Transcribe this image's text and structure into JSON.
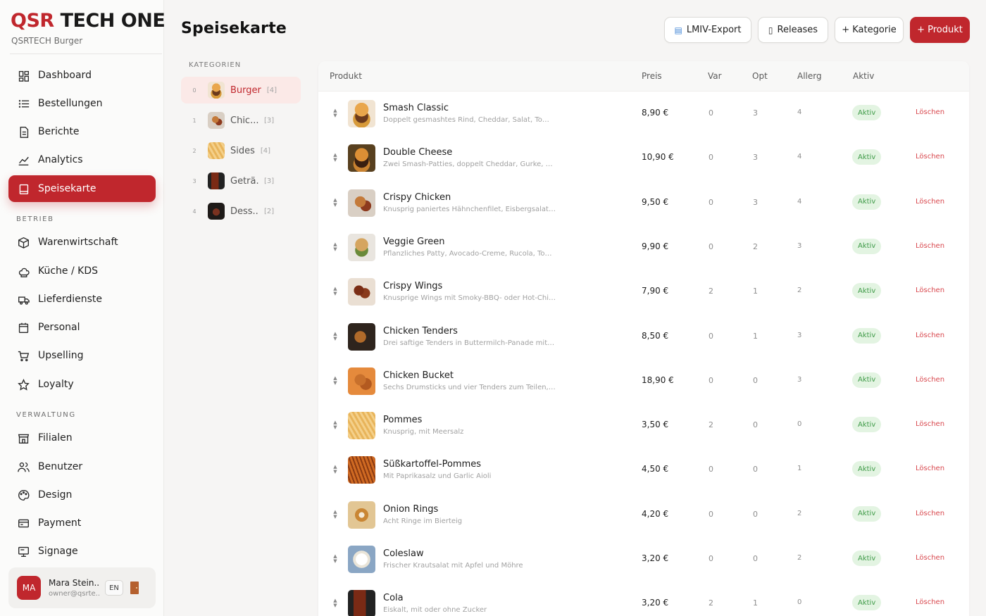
{
  "brand": {
    "qsr": "QSR",
    "rest": " TECH ONE",
    "subtitle": "QSRTECH Burger"
  },
  "nav": {
    "main": [
      {
        "label": "Dashboard",
        "icon": "dashboard-icon"
      },
      {
        "label": "Bestellungen",
        "icon": "list-icon"
      },
      {
        "label": "Berichte",
        "icon": "report-icon"
      },
      {
        "label": "Analytics",
        "icon": "chart-icon"
      },
      {
        "label": "Speisekarte",
        "icon": "menu-book-icon",
        "active": true
      }
    ],
    "betrieb_label": "BETRIEB",
    "betrieb": [
      {
        "label": "Warenwirtschaft",
        "icon": "box-icon"
      },
      {
        "label": "Küche / KDS",
        "icon": "chef-hat-icon"
      },
      {
        "label": "Lieferdienste",
        "icon": "truck-icon"
      },
      {
        "label": "Personal",
        "icon": "calendar-icon"
      },
      {
        "label": "Upselling",
        "icon": "cart-icon"
      },
      {
        "label": "Loyalty",
        "icon": "star-icon"
      }
    ],
    "verwaltung_label": "VERWALTUNG",
    "verwaltung": [
      {
        "label": "Filialen",
        "icon": "store-icon"
      },
      {
        "label": "Benutzer",
        "icon": "users-icon"
      },
      {
        "label": "Design",
        "icon": "palette-icon"
      },
      {
        "label": "Payment",
        "icon": "credit-card-icon"
      },
      {
        "label": "Signage",
        "icon": "monitor-icon"
      }
    ]
  },
  "user": {
    "initials": "MA",
    "name": "Mara Stein...",
    "email": "owner@qsrte...",
    "lang": "EN"
  },
  "header": {
    "title": "Speisekarte",
    "lmiv": "LMIV-Export",
    "releases": "Releases",
    "add_category": "+ Kategorie",
    "add_product": "+ Produkt"
  },
  "categories_label": "KATEGORIEN",
  "categories": [
    {
      "idx": "0",
      "name": "Burger",
      "count": "[4]",
      "active": true,
      "thumb": "burger"
    },
    {
      "idx": "1",
      "name": "Chic...",
      "count": "[3]",
      "thumb": "chicken"
    },
    {
      "idx": "2",
      "name": "Sides",
      "count": "[4]",
      "thumb": "fries"
    },
    {
      "idx": "3",
      "name": "Geträ...",
      "count": "[3]",
      "thumb": "drink"
    },
    {
      "idx": "4",
      "name": "Dess...",
      "count": "[2]",
      "thumb": "dessert"
    }
  ],
  "table": {
    "headers": {
      "product": "Produkt",
      "price": "Preis",
      "var": "Var",
      "opt": "Opt",
      "allerg": "Allerg",
      "active": "Aktiv"
    },
    "rows": [
      {
        "name": "Smash Classic",
        "desc": "Doppelt gesmashtes Rind, Cheddar, Salat, Tomat...",
        "price": "8,90 €",
        "var": "0",
        "opt": "3",
        "allerg": "4",
        "status": "Aktiv",
        "delete": "Löschen",
        "thumb": "burger"
      },
      {
        "name": "Double Cheese",
        "desc": "Zwei Smash-Patties, doppelt Cheddar, Gurke, Zw...",
        "price": "10,90 €",
        "var": "0",
        "opt": "3",
        "allerg": "4",
        "status": "Aktiv",
        "delete": "Löschen",
        "thumb": "burger2"
      },
      {
        "name": "Crispy Chicken",
        "desc": "Knusprig paniertes Hähnchenfilet, Eisbergsalat, ...",
        "price": "9,50 €",
        "var": "0",
        "opt": "3",
        "allerg": "4",
        "status": "Aktiv",
        "delete": "Löschen",
        "thumb": "chicken"
      },
      {
        "name": "Veggie Green",
        "desc": "Pflanzliches Patty, Avocado-Creme, Rucola, Tom...",
        "price": "9,90 €",
        "var": "0",
        "opt": "2",
        "allerg": "3",
        "status": "Aktiv",
        "delete": "Löschen",
        "thumb": "veggie"
      },
      {
        "name": "Crispy Wings",
        "desc": "Knusprige Wings mit Smoky-BBQ- oder Hot-Chil...",
        "price": "7,90 €",
        "var": "2",
        "opt": "1",
        "allerg": "2",
        "status": "Aktiv",
        "delete": "Löschen",
        "thumb": "wings"
      },
      {
        "name": "Chicken Tenders",
        "desc": "Drei saftige Tenders in Buttermilch-Panade mit ...",
        "price": "8,50 €",
        "var": "0",
        "opt": "1",
        "allerg": "3",
        "status": "Aktiv",
        "delete": "Löschen",
        "thumb": "tenders"
      },
      {
        "name": "Chicken Bucket",
        "desc": "Sechs Drumsticks und vier Tenders zum Teilen, z...",
        "price": "18,90 €",
        "var": "0",
        "opt": "0",
        "allerg": "3",
        "status": "Aktiv",
        "delete": "Löschen",
        "thumb": "bucket"
      },
      {
        "name": "Pommes",
        "desc": "Knusprig, mit Meersalz",
        "price": "3,50 €",
        "var": "2",
        "opt": "0",
        "allerg": "0",
        "status": "Aktiv",
        "delete": "Löschen",
        "thumb": "fries"
      },
      {
        "name": "Süßkartoffel-Pommes",
        "desc": "Mit Paprikasalz und Garlic Aioli",
        "price": "4,50 €",
        "var": "0",
        "opt": "0",
        "allerg": "1",
        "status": "Aktiv",
        "delete": "Löschen",
        "thumb": "sweetfries"
      },
      {
        "name": "Onion Rings",
        "desc": "Acht Ringe im Bierteig",
        "price": "4,20 €",
        "var": "0",
        "opt": "0",
        "allerg": "2",
        "status": "Aktiv",
        "delete": "Löschen",
        "thumb": "rings"
      },
      {
        "name": "Coleslaw",
        "desc": "Frischer Krautsalat mit Apfel und Möhre",
        "price": "3,20 €",
        "var": "0",
        "opt": "0",
        "allerg": "2",
        "status": "Aktiv",
        "delete": "Löschen",
        "thumb": "coleslaw"
      },
      {
        "name": "Cola",
        "desc": "Eiskalt, mit oder ohne Zucker",
        "price": "3,20 €",
        "var": "2",
        "opt": "1",
        "allerg": "0",
        "status": "Aktiv",
        "delete": "Löschen",
        "thumb": "drink"
      }
    ]
  },
  "colors": {
    "accent": "#c0272d",
    "active_badge_bg": "#e3f4e2",
    "active_badge_text": "#3e9a47",
    "delete": "#d8474d"
  }
}
